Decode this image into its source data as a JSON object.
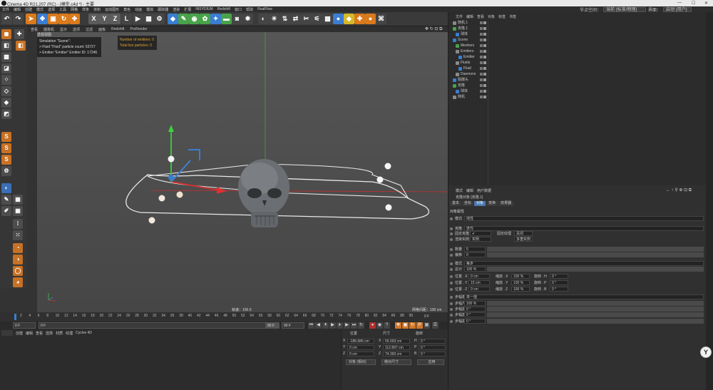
{
  "window": {
    "title": "Cinema 4D R21.207 (RC) - [模型.c4d *] - 主要",
    "controls": [
      "—",
      "☐",
      "✕"
    ]
  },
  "menubar": {
    "items": [
      "文件",
      "编辑",
      "创建",
      "模式",
      "选择",
      "工具",
      "网格",
      "样条",
      "体积",
      "运动图形",
      "角色",
      "动画",
      "模拟",
      "跟踪器",
      "渲染",
      "扩展",
      "INSYDIUM",
      "Redshift",
      "窗口",
      "帮助",
      "RealFlow"
    ],
    "node_space_label": "节点空间：",
    "node_space_value": "当前 (标准/物理)",
    "layout_label": "界面：",
    "layout_value": "启动 (用户)"
  },
  "toolbar": {
    "axis_x": "X",
    "axis_y": "Y",
    "axis_z": "Z",
    "coord_system": "L"
  },
  "viewport": {
    "menu": [
      "查看",
      "摄像机",
      "显示",
      "选项",
      "过滤",
      "面板",
      "Redshift",
      "ProRender"
    ],
    "camera_label": "透视视图",
    "simulation_title": "Simulation \"Scene\":",
    "simulation_lines": [
      "> Fluid \"Fluid\" particle count: 53727",
      "> Emitter \"Emitter\" Emitter ID: 17246"
    ],
    "emitter_info": [
      "Number of emitters: 0",
      "Total live particles: 0"
    ],
    "speed": "帧速：100.0",
    "grid_spacing": "网格间距：100 cm"
  },
  "timeline": {
    "ruler": [
      "2",
      "4",
      "6",
      "8",
      "10",
      "12",
      "14",
      "16",
      "18",
      "20",
      "22",
      "24",
      "26",
      "28",
      "30",
      "32",
      "34",
      "36",
      "38",
      "40",
      "42",
      "44",
      "46",
      "48",
      "50",
      "52",
      "54",
      "56",
      "58",
      "60",
      "62",
      "64",
      "66",
      "68",
      "70",
      "72",
      "74",
      "76",
      "78",
      "80",
      "82",
      "84",
      "86",
      "88",
      "90"
    ],
    "frame_marker": "0 F",
    "current_frame": "0 F",
    "start_field": "0 F",
    "end_field": "90 F",
    "max_field": "90 F"
  },
  "material_panel": {
    "menu": [
      "创建",
      "编辑",
      "查看",
      "选择",
      "材质",
      "纹理",
      "Cycles 4D"
    ]
  },
  "coordinates": {
    "headers": [
      "位置",
      "尺寸",
      "旋转"
    ],
    "rows": [
      {
        "axis": "X",
        "pos": "-186.686 cm",
        "size_axis": "X",
        "size": "55.003 cm",
        "rot_axis": "H",
        "rot": "0 °"
      },
      {
        "axis": "Y",
        "pos": "0 cm",
        "size_axis": "Y",
        "size": "112.897 cm",
        "rot_axis": "P",
        "rot": "0 °"
      },
      {
        "axis": "Z",
        "pos": "0 cm",
        "size_axis": "Z",
        "size": "74.393 cm",
        "rot_axis": "B",
        "rot": "0 °"
      }
    ],
    "mode_dropdown": "对象 (相对)",
    "size_dropdown": "绝对尺寸",
    "apply_button": "应用"
  },
  "object_manager": {
    "menu": [
      "文件",
      "编辑",
      "查看",
      "对象",
      "标签",
      "书签"
    ],
    "objects": [
      {
        "name": "随机.1",
        "indent": 0,
        "color": "#8a8a8a"
      },
      {
        "name": "克隆.1",
        "indent": 0,
        "color": "#49a34a"
      },
      {
        "name": "球体",
        "indent": 1,
        "color": "#3a7dd1"
      },
      {
        "name": "Scene",
        "indent": 0,
        "color": "#3a7dd1"
      },
      {
        "name": "Meshers",
        "indent": 1,
        "color": "#49a34a"
      },
      {
        "name": "Emitters",
        "indent": 1,
        "color": "#8a8a8a"
      },
      {
        "name": "Emitter",
        "indent": 2,
        "color": "#3a7dd1"
      },
      {
        "name": "Fluids",
        "indent": 1,
        "color": "#8a8a8a"
      },
      {
        "name": "Fluid",
        "indent": 2,
        "color": "#3a7dd1"
      },
      {
        "name": "Daemons",
        "indent": 1,
        "color": "#8a8a8a"
      },
      {
        "name": "骷髅头",
        "indent": 0,
        "color": "#3a7dd1"
      },
      {
        "name": "克隆",
        "indent": 0,
        "color": "#49a34a"
      },
      {
        "name": "球体",
        "indent": 1,
        "color": "#3a7dd1"
      },
      {
        "name": "随机",
        "indent": 0,
        "color": "#8a8a8a"
      }
    ]
  },
  "attributes": {
    "menu": [
      "模式",
      "编辑",
      "用户数据"
    ],
    "title": "克隆对象 [克隆.1]",
    "tabs": [
      "基本",
      "坐标",
      "对象",
      "变换",
      "效果器"
    ],
    "active_tab": "对象",
    "section": "对象属性",
    "rows": [
      {
        "label": "模式",
        "value": "线性"
      },
      {
        "label": "克隆",
        "value": "迭代"
      },
      {
        "label": "固定克隆",
        "value": "✔",
        "extra_label": "固定纹理",
        "extra_value": "关闭"
      },
      {
        "label": "渲染实例",
        "value": "实例",
        "extra_label": "",
        "extra_value": "多重实例"
      },
      {
        "label": "数量",
        "value": "5"
      },
      {
        "label": "偏移",
        "value": "0"
      },
      {
        "label": "模式",
        "value": "每步"
      },
      {
        "label": "总计",
        "value": "100 %"
      },
      {
        "label": "位置 . X",
        "value": "0 cm",
        "mid_label": "缩放 . X",
        "mid_value": "100 %",
        "end_label": "旋转 . H",
        "end_value": "0 °"
      },
      {
        "label": "位置 . Y",
        "value": "15 cm",
        "mid_label": "缩放 . Y",
        "mid_value": "100 %",
        "end_label": "旋转 . P",
        "end_value": "0 °"
      },
      {
        "label": "位置 . Z",
        "value": "0 cm",
        "mid_label": "缩放 . Z",
        "mid_value": "100 %",
        "end_label": "旋转 . B",
        "end_value": "0 °"
      },
      {
        "label": "步幅模式",
        "value": "单一值"
      },
      {
        "label": "步幅尺寸",
        "value": "100 %"
      },
      {
        "label": "步幅旋转 . H",
        "value": "0 °"
      },
      {
        "label": "步幅旋转 . P",
        "value": "0 °"
      },
      {
        "label": "步幅旋转 . B",
        "value": "0 °"
      }
    ]
  },
  "corner_logo": "Y"
}
